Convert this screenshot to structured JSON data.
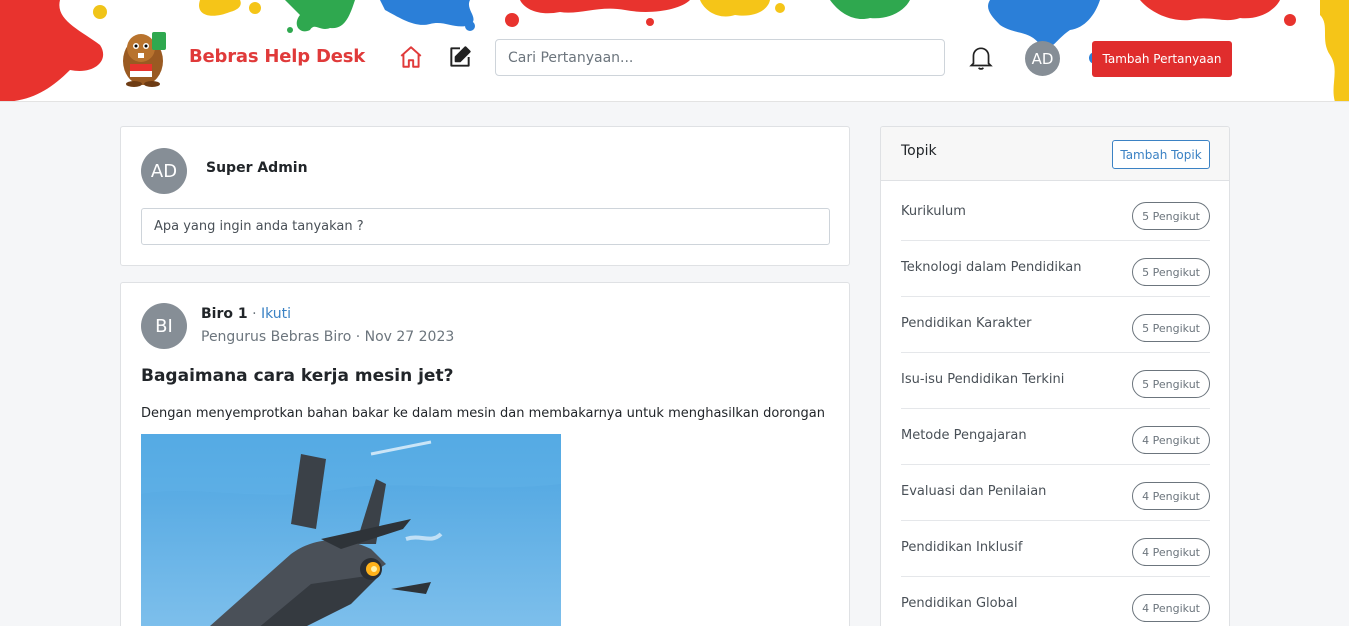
{
  "header": {
    "brand": "Bebras Help Desk",
    "search_placeholder": "Cari Pertanyaan...",
    "user_initials": "AD",
    "add_question_label": "Tambah Pertanyaan",
    "icons": [
      "beaver-logo",
      "home-icon",
      "edit-icon",
      "bell-icon"
    ],
    "accent_color": "#e02d2d"
  },
  "ask": {
    "user_initials": "AD",
    "user_name": "Super Admin",
    "prompt": "Apa yang ingin anda tanyakan ?"
  },
  "post": {
    "author_initials": "BI",
    "author_name": "Biro 1",
    "separator": "·",
    "follow_label": "Ikuti",
    "meta": "Pengurus Bebras Biro · Nov 27 2023",
    "title": "Bagaimana cara kerja mesin jet?",
    "body": "Dengan menyemprotkan bahan bakar ke dalam mesin dan membakarnya untuk menghasilkan dorongan",
    "image": "fighter-jet-photo"
  },
  "topics": {
    "title": "Topik",
    "add_label": "Tambah Topik",
    "items": [
      {
        "name": "Kurikulum",
        "followers": "5 Pengikut"
      },
      {
        "name": "Teknologi dalam Pendidikan",
        "followers": "5 Pengikut"
      },
      {
        "name": "Pendidikan Karakter",
        "followers": "5 Pengikut"
      },
      {
        "name": "Isu-isu Pendidikan Terkini",
        "followers": "5 Pengikut"
      },
      {
        "name": "Metode Pengajaran",
        "followers": "4 Pengikut"
      },
      {
        "name": "Evaluasi dan Penilaian",
        "followers": "4 Pengikut"
      },
      {
        "name": "Pendidikan Inklusif",
        "followers": "4 Pengikut"
      },
      {
        "name": "Pendidikan Global",
        "followers": "4 Pengikut"
      }
    ]
  }
}
